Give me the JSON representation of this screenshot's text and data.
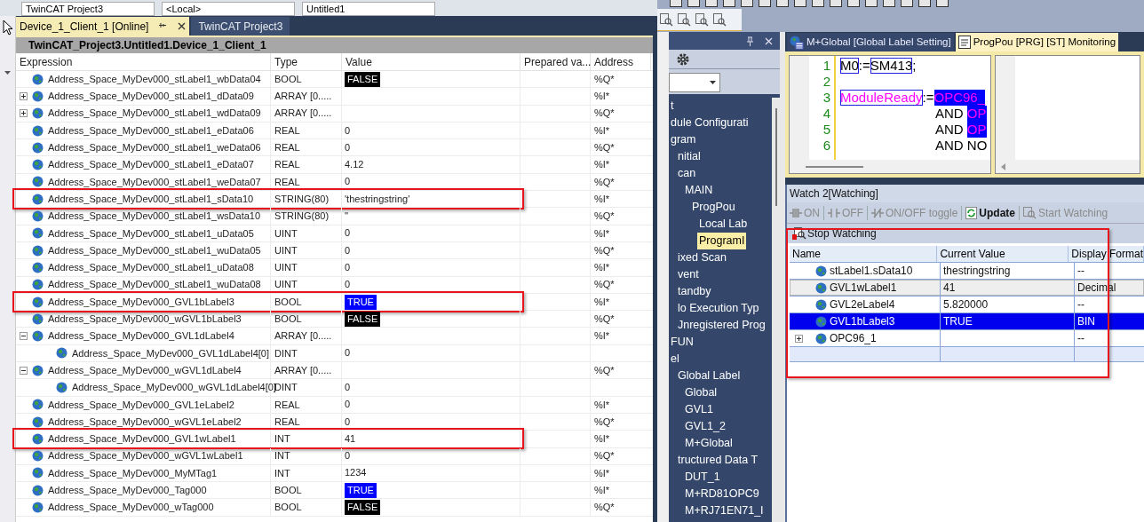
{
  "left_window": {
    "toolbar_fields": [
      "TwinCAT Project3",
      "<Local>",
      "Untitled1"
    ],
    "tabs": [
      {
        "label": "Device_1_Client_1 [Online]",
        "selected": true
      },
      {
        "label": "TwinCAT Project3",
        "selected": false
      }
    ],
    "title": "TwinCAT_Project3.Untitled1.Device_1_Client_1",
    "table": {
      "columns": [
        "Expression",
        "Type",
        "Value",
        "Prepared va...",
        "Address"
      ],
      "rows": [
        {
          "expression": "Address_Space_MyDev000_stLabel1_wbData04",
          "type": "BOOL",
          "value": "FALSE",
          "kind": "off",
          "address": "%Q*",
          "highlighted": false
        },
        {
          "expression": "Address_Space_MyDev000_stLabel1_dData09",
          "type": "ARRAY [0.....",
          "address": "%I*",
          "highlighted": false,
          "expanded": false
        },
        {
          "expression": "Address_Space_MyDev000_stLabel1_wdData09",
          "type": "ARRAY [0.....",
          "address": "%Q*",
          "highlighted": false,
          "expanded": false
        },
        {
          "expression": "Address_Space_MyDev000_stLabel1_eData06",
          "type": "REAL",
          "value": "0",
          "kind": "text",
          "address": "%I*",
          "highlighted": false
        },
        {
          "expression": "Address_Space_MyDev000_stLabel1_weData06",
          "type": "REAL",
          "value": "0",
          "kind": "text",
          "address": "%Q*",
          "highlighted": false
        },
        {
          "expression": "Address_Space_MyDev000_stLabel1_eData07",
          "type": "REAL",
          "value": "4.12",
          "kind": "text",
          "address": "%I*",
          "highlighted": false
        },
        {
          "expression": "Address_Space_MyDev000_stLabel1_weData07",
          "type": "REAL",
          "value": "0",
          "kind": "text",
          "address": "%Q*",
          "highlighted": false
        },
        {
          "expression": "Address_Space_MyDev000_stLabel1_sData10",
          "type": "STRING(80)",
          "value": "'thestringstring'",
          "kind": "text",
          "address": "%I*",
          "highlighted": true
        },
        {
          "expression": "Address_Space_MyDev000_stLabel1_wsData10",
          "type": "STRING(80)",
          "value": "''",
          "kind": "text",
          "address": "%Q*",
          "highlighted": false
        },
        {
          "expression": "Address_Space_MyDev000_stLabel1_uData05",
          "type": "UINT",
          "value": "0",
          "kind": "text",
          "address": "%I*",
          "highlighted": false
        },
        {
          "expression": "Address_Space_MyDev000_stLabel1_wuData05",
          "type": "UINT",
          "value": "0",
          "kind": "text",
          "address": "%Q*",
          "highlighted": false
        },
        {
          "expression": "Address_Space_MyDev000_stLabel1_uData08",
          "type": "UINT",
          "value": "0",
          "kind": "text",
          "address": "%I*",
          "highlighted": false
        },
        {
          "expression": "Address_Space_MyDev000_stLabel1_wuData08",
          "type": "UINT",
          "value": "0",
          "kind": "text",
          "address": "%Q*",
          "highlighted": false
        },
        {
          "expression": "Address_Space_MyDev000_GVL1bLabel3",
          "type": "BOOL",
          "value": "TRUE",
          "kind": "on",
          "address": "%I*",
          "highlighted": true
        },
        {
          "expression": "Address_Space_MyDev000_wGVL1bLabel3",
          "type": "BOOL",
          "value": "FALSE",
          "kind": "off",
          "address": "%Q*",
          "highlighted": false
        },
        {
          "expression": "Address_Space_MyDev000_GVL1dLabel4",
          "type": "ARRAY [0.....",
          "address": "%I*",
          "highlighted": false,
          "expanded": true,
          "children": [
            {
              "expression": "Address_Space_MyDev000_GVL1dLabel4[0]",
              "type": "DINT",
              "value": "0",
              "kind": "text",
              "highlighted": false
            }
          ]
        },
        {
          "expression": "Address_Space_MyDev000_wGVL1dLabel4",
          "type": "ARRAY [0.....",
          "address": "%Q*",
          "highlighted": false,
          "expanded": true,
          "children": [
            {
              "expression": "Address_Space_MyDev000_wGVL1dLabel4[0]",
              "type": "DINT",
              "value": "0",
              "kind": "text",
              "highlighted": false
            }
          ]
        },
        {
          "expression": "Address_Space_MyDev000_GVL1eLabel2",
          "type": "REAL",
          "value": "0",
          "kind": "text",
          "address": "%I*",
          "highlighted": false
        },
        {
          "expression": "Address_Space_MyDev000_wGVL1eLabel2",
          "type": "REAL",
          "value": "0",
          "kind": "text",
          "address": "%Q*",
          "highlighted": false
        },
        {
          "expression": "Address_Space_MyDev000_GVL1wLabel1",
          "type": "INT",
          "value": "41",
          "kind": "text",
          "address": "%I*",
          "highlighted": true
        },
        {
          "expression": "Address_Space_MyDev000_wGVL1wLabel1",
          "type": "INT",
          "value": "0",
          "kind": "text",
          "address": "%Q*",
          "highlighted": false
        },
        {
          "expression": "Address_Space_MyDev000_MyMTag1",
          "type": "INT",
          "value": "1234",
          "kind": "text",
          "address": "%I*",
          "highlighted": false
        },
        {
          "expression": "Address_Space_MyDev000_Tag000",
          "type": "BOOL",
          "value": "TRUE",
          "kind": "on",
          "address": "%I*",
          "highlighted": false
        },
        {
          "expression": "Address_Space_MyDev000_wTag000",
          "type": "BOOL",
          "value": "FALSE",
          "kind": "off",
          "address": "%Q*",
          "highlighted": false
        }
      ]
    }
  },
  "right_window": {
    "navigator": {
      "items": [
        {
          "label": "t",
          "selected": false
        },
        {
          "label": "dule Configurati",
          "selected": false
        },
        {
          "label": "gram",
          "selected": false,
          "children": [
            {
              "label": "nitial",
              "selected": false
            },
            {
              "label": "can",
              "selected": false,
              "children": [
                {
                  "label": "MAIN",
                  "selected": false,
                  "children": [
                    {
                      "label": "ProgPou",
                      "selected": false,
                      "children": [
                        {
                          "label": "Local Lab",
                          "selected": false
                        },
                        {
                          "label": "ProgramI",
                          "selected": true
                        }
                      ]
                    }
                  ]
                }
              ]
            },
            {
              "label": "ixed Scan",
              "selected": false
            },
            {
              "label": "vent",
              "selected": false
            },
            {
              "label": "tandby",
              "selected": false
            },
            {
              "label": "lo Execution Typ",
              "selected": false
            },
            {
              "label": "Jnregistered Prog",
              "selected": false
            }
          ]
        },
        {
          "label": "FUN",
          "selected": false
        },
        {
          "label": "el",
          "selected": false,
          "children": [
            {
              "label": "Global Label",
              "selected": false,
              "children": [
                {
                  "label": "Global",
                  "selected": false
                },
                {
                  "label": "GVL1",
                  "selected": false
                },
                {
                  "label": "GVL1_2",
                  "selected": false
                },
                {
                  "label": "M+Global",
                  "selected": false
                }
              ]
            },
            {
              "label": "tructured Data T",
              "selected": false,
              "children": [
                {
                  "label": "DUT_1",
                  "selected": false
                },
                {
                  "label": "M+RD81OPC9",
                  "selected": false
                },
                {
                  "label": "M+RJ71EN71_I",
                  "selected": false
                }
              ]
            }
          ]
        }
      ]
    },
    "editor_tabs": [
      {
        "label": "M+Global [Global Label Setting]",
        "kind": "global",
        "selected": false
      },
      {
        "label": "ProgPou [PRG] [ST] Monitoring",
        "kind": "st",
        "selected": true
      }
    ],
    "code_lines": [
      {
        "number": "1",
        "indent": false,
        "tokens": [
          {
            "text": "M0",
            "kind": "boxed"
          },
          {
            "text": ":=",
            "kind": "plain"
          },
          {
            "text": "SM413",
            "kind": "boxed"
          },
          {
            "text": ";",
            "kind": "plain"
          }
        ]
      },
      {
        "number": "2"
      },
      {
        "number": "3",
        "indent": false,
        "tokens": [
          {
            "text": "ModuleReady",
            "kind": "boxed_label"
          },
          {
            "text": ":=",
            "kind": "plain"
          },
          {
            "text": "OPC96_",
            "kind": "selected_label"
          }
        ]
      },
      {
        "number": "4",
        "indent": true,
        "tokens": [
          {
            "text": "AND ",
            "kind": "plain"
          },
          {
            "text": "OP",
            "kind": "selected_label"
          }
        ]
      },
      {
        "number": "5",
        "indent": true,
        "tokens": [
          {
            "text": "AND ",
            "kind": "plain"
          },
          {
            "text": "OP",
            "kind": "selected_label"
          }
        ]
      },
      {
        "number": "6",
        "indent": true,
        "tokens": [
          {
            "text": "AND NO",
            "kind": "plain"
          }
        ]
      }
    ],
    "watch": {
      "title": "Watch 2[Watching]",
      "highlighted": true,
      "buttons": [
        {
          "label": "ON",
          "kind": "on",
          "disabled": true
        },
        {
          "label": "OFF",
          "kind": "off",
          "disabled": true
        },
        {
          "label": "ON/OFF toggle",
          "kind": "toggle",
          "disabled": true
        },
        {
          "label": "Update",
          "kind": "update",
          "disabled": false
        },
        {
          "label": "Start Watching",
          "kind": "start",
          "disabled": true
        }
      ],
      "stop_button": {
        "label": "Stop Watching",
        "disabled": false
      },
      "columns": [
        "Name",
        "Current Value",
        "Display Format"
      ],
      "rows": [
        {
          "name": "stLabel1.sData10",
          "value": "thestringstring",
          "format": "--",
          "selected": false,
          "hovered": false
        },
        {
          "name": "GVL1wLabel1",
          "value": "41",
          "format": "Decimal",
          "selected": false,
          "hovered": true
        },
        {
          "name": "GVL2eLabel4",
          "value": "5.820000",
          "format": "--",
          "selected": false,
          "hovered": false
        },
        {
          "name": "GVL1bLabel3",
          "value": "TRUE",
          "format": "BIN",
          "selected": true,
          "hovered": false
        },
        {
          "name": "OPC96_1",
          "format": "--",
          "selected": false,
          "hovered": false,
          "expanded": false
        }
      ]
    }
  }
}
